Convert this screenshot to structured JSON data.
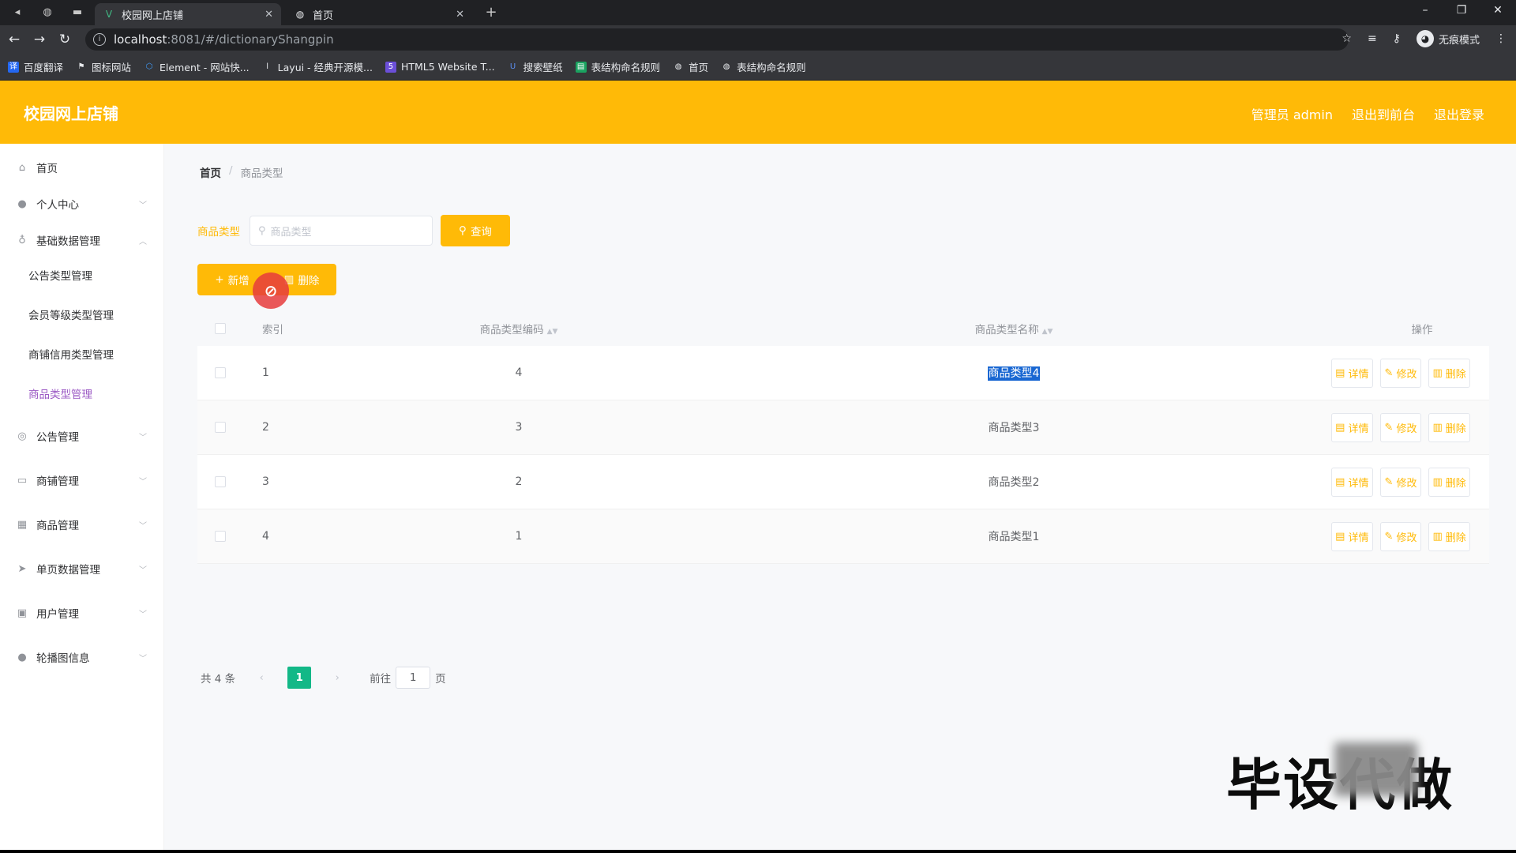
{
  "browser": {
    "tabs": [
      {
        "title": "校园网上店铺",
        "active": true
      },
      {
        "title": "首页",
        "active": false
      }
    ],
    "address": {
      "host": "localhost",
      "path": ":8081/#/dictionaryShangpin"
    },
    "incognito_label": "无痕模式",
    "bookmarks": [
      {
        "label": "百度翻译",
        "icon": "translate-icon",
        "color": "#2468f2"
      },
      {
        "label": "图标网站",
        "icon": "flag-icon",
        "color": "#444444"
      },
      {
        "label": "Element - 网站快...",
        "icon": "element-icon",
        "color": "#409eff"
      },
      {
        "label": "Layui - 经典开源模...",
        "icon": "layui-icon",
        "color": "#555555"
      },
      {
        "label": "HTML5 Website T...",
        "icon": "html5-icon",
        "color": "#6b4fd8"
      },
      {
        "label": "搜索壁纸",
        "icon": "wallpaper-icon",
        "color": "#3f6cd8"
      },
      {
        "label": "表结构命名规则",
        "icon": "doc-icon",
        "color": "#1aa260"
      },
      {
        "label": "首页",
        "icon": "globe-icon",
        "color": "#5f6368"
      },
      {
        "label": "表结构命名规则",
        "icon": "globe-icon",
        "color": "#5f6368"
      }
    ]
  },
  "colors": {
    "brand": "#ffba07",
    "page_active": "#13b887",
    "submenu_active": "#9b59c4"
  },
  "header": {
    "title": "校园网上店铺",
    "links": [
      "管理员 admin",
      "退出到前台",
      "退出登录"
    ]
  },
  "sidebar": {
    "items": [
      {
        "label": "首页",
        "icon": "home-icon"
      },
      {
        "label": "个人中心",
        "icon": "user-icon"
      },
      {
        "label": "基础数据管理",
        "icon": "mic-icon"
      },
      {
        "label": "公告管理",
        "icon": "compass-icon"
      },
      {
        "label": "商铺管理",
        "icon": "chat-icon"
      },
      {
        "label": "商品管理",
        "icon": "grid-icon"
      },
      {
        "label": "单页数据管理",
        "icon": "send-icon"
      },
      {
        "label": "用户管理",
        "icon": "camera-icon"
      },
      {
        "label": "轮播图信息",
        "icon": "location-icon"
      }
    ],
    "submenu": [
      "公告类型管理",
      "会员等级类型管理",
      "商铺信用类型管理",
      "商品类型管理"
    ]
  },
  "breadcrumb": {
    "home": "首页",
    "separator": "/",
    "current": "商品类型"
  },
  "search": {
    "label": "商品类型",
    "placeholder": "商品类型",
    "button": "查询"
  },
  "actions": {
    "add": "新增",
    "delete": "删除"
  },
  "table": {
    "columns": [
      "索引",
      "商品类型编码",
      "商品类型名称",
      "操作"
    ],
    "rows": [
      {
        "index": "1",
        "code": "4",
        "name": "商品类型4"
      },
      {
        "index": "2",
        "code": "3",
        "name": "商品类型3"
      },
      {
        "index": "3",
        "code": "2",
        "name": "商品类型2"
      },
      {
        "index": "4",
        "code": "1",
        "name": "商品类型1"
      }
    ],
    "row_actions": {
      "detail": "详情",
      "edit": "修改",
      "delete": "删除"
    }
  },
  "pagination": {
    "total": "共 4 条",
    "current_page": "1",
    "goto_prefix": "前往",
    "goto_value": "1",
    "goto_suffix": "页"
  },
  "watermark": "毕设代做"
}
